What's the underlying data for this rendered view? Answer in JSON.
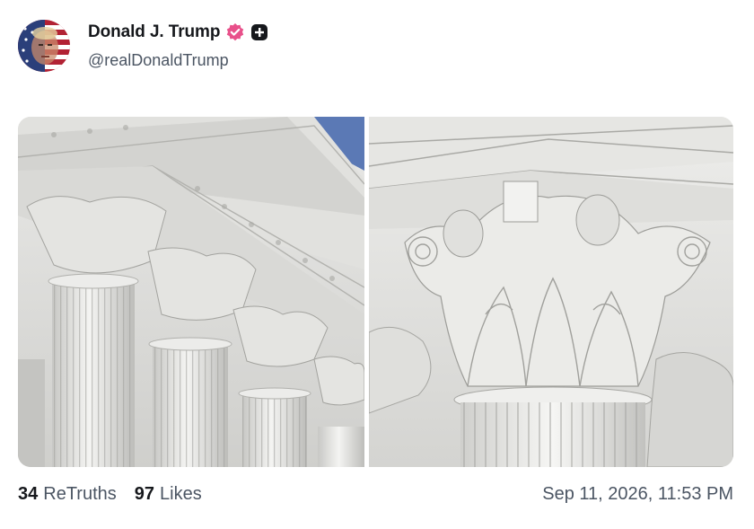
{
  "author": {
    "display_name": "Donald J. Trump",
    "handle": "@realDonaldTrump",
    "verified_badge_color": "#e8508a",
    "plus_badge_color": "#16181c"
  },
  "media": [
    {
      "description_icon": "image-icon"
    },
    {
      "description_icon": "image-icon"
    }
  ],
  "stats": {
    "retruths_count": "34",
    "retruths_label": "ReTruths",
    "likes_count": "97",
    "likes_label": "Likes"
  },
  "timestamp": "Sep 11, 2026, 11:53 PM"
}
